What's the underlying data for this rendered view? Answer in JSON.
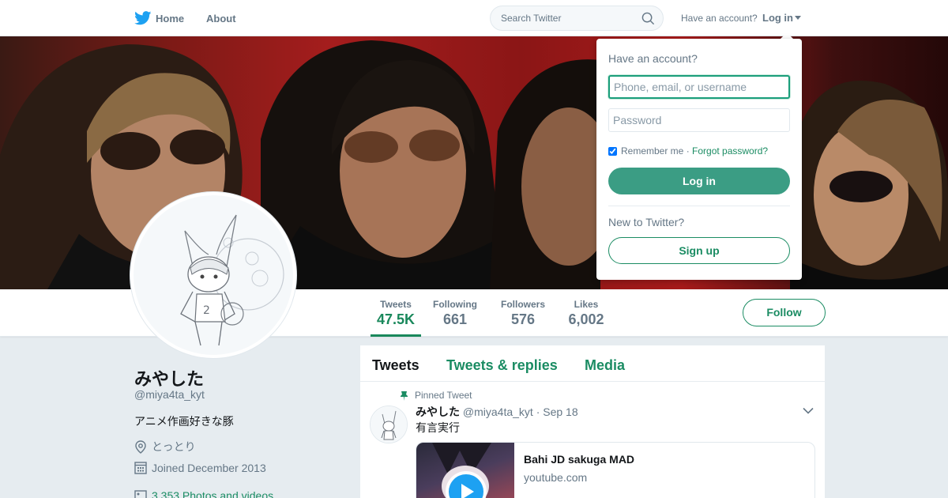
{
  "nav": {
    "home_label": "Home",
    "about_label": "About",
    "search_placeholder": "Search Twitter",
    "have_account": "Have an account?",
    "login_label": "Log in"
  },
  "profile": {
    "name": "みやした",
    "handle": "@miya4ta_kyt",
    "bio": "アニメ作画好きな豚",
    "location": "とっとり",
    "joined": "Joined December 2013",
    "photos": "3,353 Photos and videos"
  },
  "stats": [
    {
      "label": "Tweets",
      "value": "47.5K"
    },
    {
      "label": "Following",
      "value": "661"
    },
    {
      "label": "Followers",
      "value": "576"
    },
    {
      "label": "Likes",
      "value": "6,002"
    }
  ],
  "follow_label": "Follow",
  "timeline": {
    "tabs": [
      "Tweets",
      "Tweets & replies",
      "Media"
    ],
    "pinned_label": "Pinned Tweet",
    "tweet": {
      "name": "みやした",
      "handle": "@miya4ta_kyt",
      "date": "· Sep 18",
      "text": "有言実行",
      "card_title": "Bahi JD sakuga MAD",
      "card_domain": "youtube.com"
    }
  },
  "login_dropdown": {
    "heading": "Have an account?",
    "username_placeholder": "Phone, email, or username",
    "password_placeholder": "Password",
    "remember_label": "Remember me ·",
    "forgot_label": "Forgot password?",
    "login_button": "Log in",
    "new_label": "New to Twitter?",
    "signup_button": "Sign up"
  },
  "colors": {
    "accent": "#1b8c63",
    "login_button": "#3b9d84"
  }
}
